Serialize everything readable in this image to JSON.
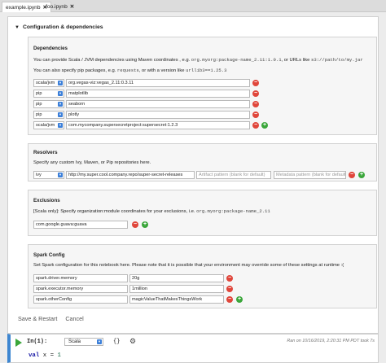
{
  "tabs": [
    {
      "label": "example.ipynb",
      "close": "✕",
      "active": true
    },
    {
      "label": "foo.ipynb",
      "close": "✕",
      "active": false
    }
  ],
  "config": {
    "title": "Configuration & dependencies",
    "dependencies": {
      "title": "Dependencies",
      "desc1_prefix": "You can provide Scala / JVM dependencies using Maven coordinates , e.g. ",
      "desc1_code1": "org.myorg:package-name_2.11:1.0.1",
      "desc1_mid": ", or URLs like ",
      "desc1_code2": "s3://path/to/my.jar",
      "desc2_prefix": "You can also specify pip packages, e.g. ",
      "desc2_code1": "requests",
      "desc2_mid": ", or with a version like ",
      "desc2_code2": "urllib3==1.25.3",
      "rows": [
        {
          "type": "scala/jvm",
          "value": "org.vegas-viz:vegas_2.11:0.3.11"
        },
        {
          "type": "pip",
          "value": "matplotlib"
        },
        {
          "type": "pip",
          "value": "seaborn"
        },
        {
          "type": "pip",
          "value": "plotly"
        },
        {
          "type": "scala/jvm",
          "value": "com.mycompany.supersecretproject:supersecret:1.2.3"
        }
      ]
    },
    "resolvers": {
      "title": "Resolvers",
      "desc": "Specify any custom Ivy, Maven, or Pip repositories here.",
      "type": "ivy",
      "url": "http://my.super.cool.company.repo/super-secret-releases",
      "artifact_placeholder": "Artifact pattern (blank for default)",
      "metadata_placeholder": "Metadata pattern (blank for default)"
    },
    "exclusions": {
      "title": "Exclusions",
      "desc_prefix": "[Scala only]: Specify organization:module coordinates for your exclusions, i.e. ",
      "desc_code": "org.myorg:package-name_2.11",
      "value": "com.google.guava:guava"
    },
    "spark": {
      "title": "Spark Config",
      "desc": "Set Spark configuration for this notebook here. Please note that it is possible that your environment may override some of these settings at runtime :(",
      "rows": [
        {
          "key": "spark.driver.memory",
          "value": "20g"
        },
        {
          "key": "spark.executor.memory",
          "value": "1million"
        },
        {
          "key": "spark.otherConfig",
          "value": "magicValueThatMakesThingsWork"
        }
      ]
    },
    "save_label": "Save & Restart",
    "cancel_label": "Cancel"
  },
  "cell": {
    "prompt": "In(1):",
    "language": "Scala",
    "braces": "{}",
    "run_info": "Ran on 10/16/2019, 2:20:31 PM PDT took 7s",
    "code_kw": "val",
    "code_rest": " x = ",
    "code_num": "1"
  },
  "colors": {
    "accent": "#3d86d1",
    "remove": "#e0463b",
    "add": "#3aa63a"
  }
}
